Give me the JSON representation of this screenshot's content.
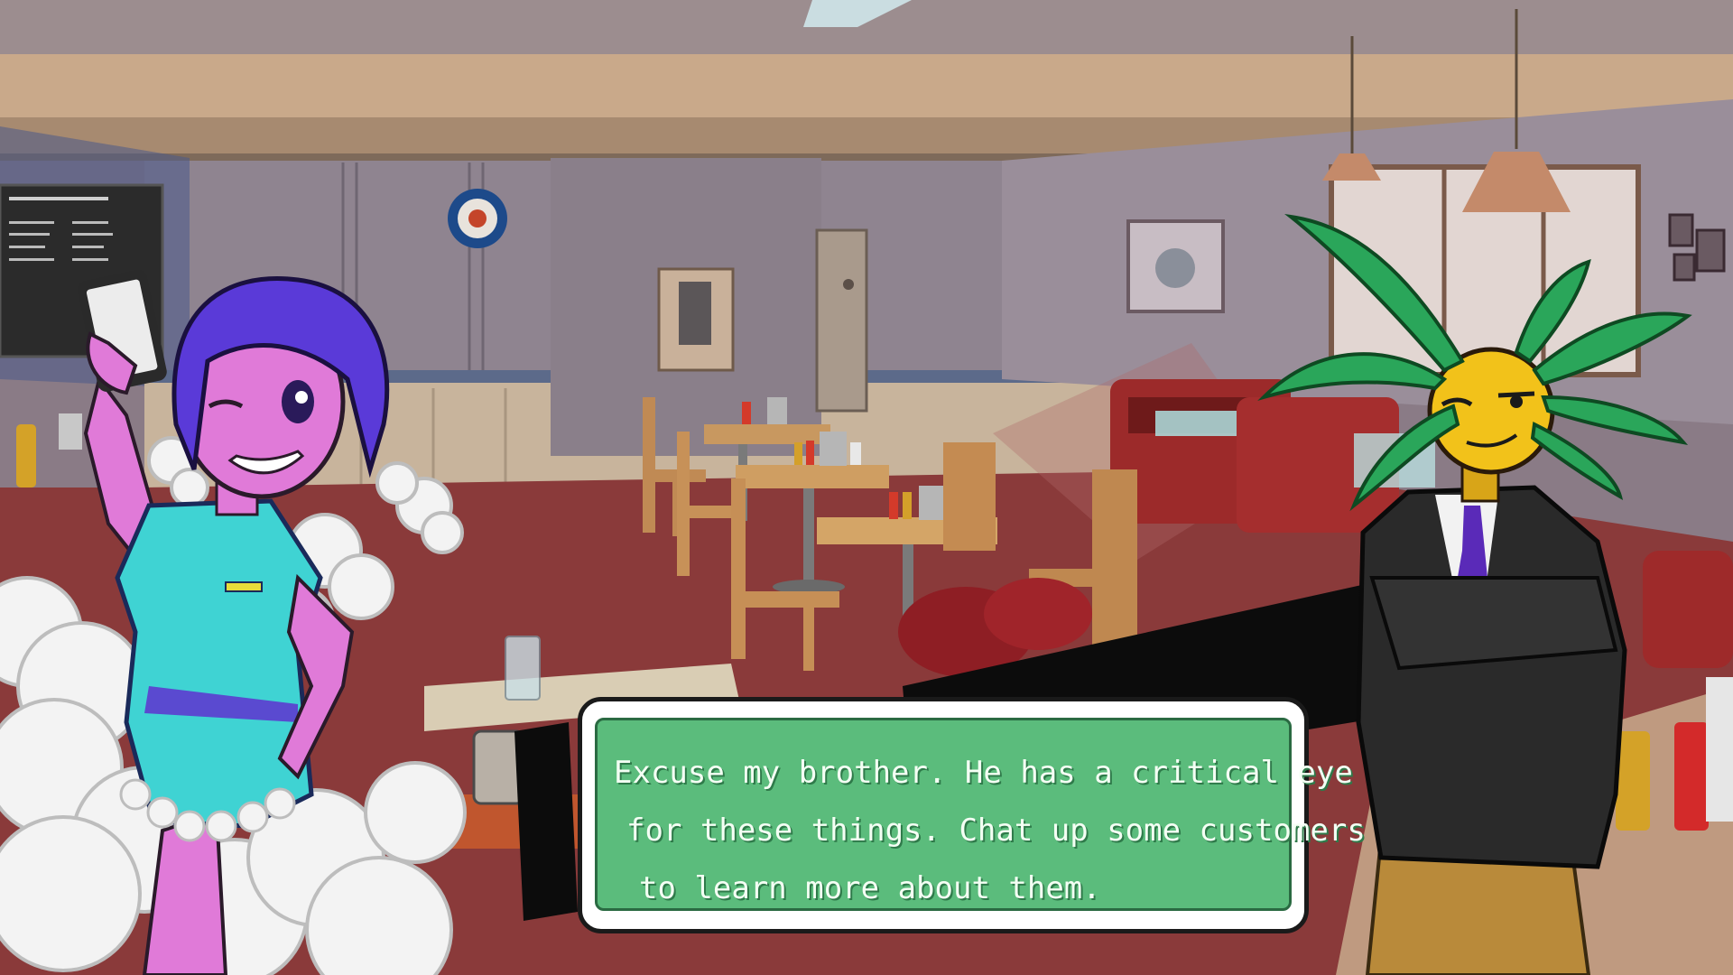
{
  "dialog": {
    "speaker": "",
    "lines": [
      "Excuse my brother. He has a critical eye",
      "for these things. Chat up some customers",
      "to learn more about them."
    ]
  },
  "colors": {
    "dialog_fill": "#5bbc7c",
    "dialog_text": "#f4fff4",
    "dialog_frame": "#ffffff",
    "waitress_skin": "#e07ad8",
    "waitress_hair": "#5a3ad8",
    "waitress_uniform": "#3fd3d3",
    "brother_head": "#f2c21a",
    "brother_leaves": "#2aa65a",
    "wall": "#8f8490",
    "floor": "#8a3a3a"
  },
  "icons": {
    "wall_clock": "clock-icon",
    "menu_board": "menu-board",
    "pay_phone": "phone-icon"
  }
}
